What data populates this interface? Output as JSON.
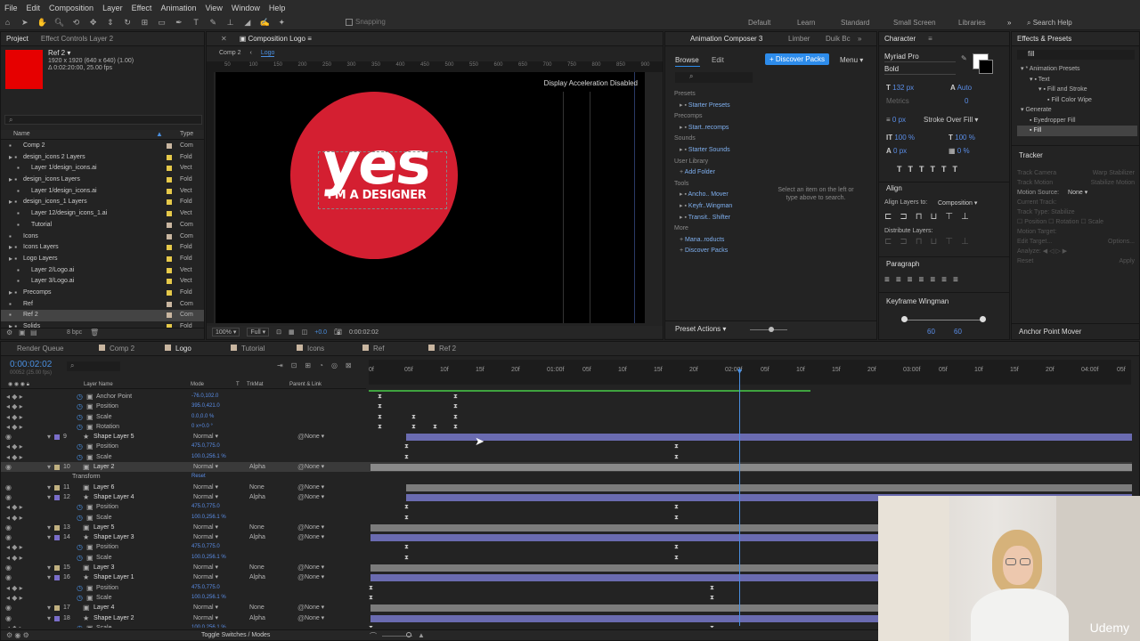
{
  "menu": [
    "File",
    "Edit",
    "Composition",
    "Layer",
    "Effect",
    "Animation",
    "View",
    "Window",
    "Help"
  ],
  "toolbar": {
    "snapping": "Snapping",
    "workspaces": [
      "Default",
      "Learn",
      "Standard",
      "Small Screen",
      "Libraries"
    ],
    "search": "Search Help"
  },
  "project": {
    "tabs": [
      "Project",
      "Effect Controls Layer 2"
    ],
    "selected_name": "Ref 2 ▾",
    "selected_info1": "1920 x 1920 (640 x 640) (1.00)",
    "selected_info2": "Δ 0:02:20:00, 25.00 fps",
    "col_name": "Name",
    "col_type": "Type",
    "bpc": "8 bpc",
    "items": [
      {
        "name": "Comp 2",
        "type": "Com",
        "color": "#c9b6a0",
        "indent": 1
      },
      {
        "name": "design_icons 2 Layers",
        "type": "Fold",
        "color": "#e6c94a",
        "indent": 1
      },
      {
        "name": "Layer 1/design_icons.ai",
        "type": "Vect",
        "color": "#e6c94a",
        "indent": 2
      },
      {
        "name": "design_icons Layers",
        "type": "Fold",
        "color": "#e6c94a",
        "indent": 1
      },
      {
        "name": "Layer 1/design_icons.ai",
        "type": "Vect",
        "color": "#e6c94a",
        "indent": 2
      },
      {
        "name": "design_icons_1 Layers",
        "type": "Fold",
        "color": "#e6c94a",
        "indent": 1
      },
      {
        "name": "Layer 12/design_icons_1.ai",
        "type": "Vect",
        "color": "#e6c94a",
        "indent": 2
      },
      {
        "name": "Tutorial",
        "type": "Com",
        "color": "#c9b6a0",
        "indent": 2
      },
      {
        "name": "Icons",
        "type": "Com",
        "color": "#c9b6a0",
        "indent": 1
      },
      {
        "name": "Icons Layers",
        "type": "Fold",
        "color": "#e6c94a",
        "indent": 1
      },
      {
        "name": "Logo Layers",
        "type": "Fold",
        "color": "#e6c94a",
        "indent": 1
      },
      {
        "name": "Layer 2/Logo.ai",
        "type": "Vect",
        "color": "#e6c94a",
        "indent": 2
      },
      {
        "name": "Layer 3/Logo.ai",
        "type": "Vect",
        "color": "#e6c94a",
        "indent": 2
      },
      {
        "name": "Precomps",
        "type": "Fold",
        "color": "#e6c94a",
        "indent": 1
      },
      {
        "name": "Ref",
        "type": "Com",
        "color": "#c9b6a0",
        "indent": 1
      },
      {
        "name": "Ref 2",
        "type": "Com",
        "color": "#c9b6a0",
        "indent": 1,
        "selected": true
      },
      {
        "name": "Solids",
        "type": "Fold",
        "color": "#e6c94a",
        "indent": 1
      }
    ]
  },
  "comp": {
    "tab": "Composition Logo",
    "crumbs": [
      "Comp 2",
      "Logo"
    ],
    "accel": "Display Acceleration Disabled",
    "logo_big": "yes",
    "logo_small": "I'M A DESIGNER",
    "zoom": "100%",
    "res": "Full",
    "time": "0:00:02:02",
    "plus": "+0.0",
    "ruler": [
      "50",
      "100",
      "150",
      "200",
      "250",
      "300",
      "350",
      "400",
      "450",
      "500",
      "550",
      "600",
      "650",
      "700",
      "750",
      "800",
      "850",
      "900"
    ]
  },
  "ac3": {
    "tabs": [
      "Animation Composer 3",
      "Limber",
      "Duik Bc"
    ],
    "browse": "Browse",
    "edit": "Edit",
    "discover": "Discover Packs",
    "menu_btn": "Menu",
    "sections": [
      {
        "head": "Presets",
        "items": [
          "Starter Presets"
        ]
      },
      {
        "head": "Precomps",
        "items": [
          "Start..recomps"
        ]
      },
      {
        "head": "Sounds",
        "items": [
          "Starter Sounds"
        ]
      },
      {
        "head": "User Library",
        "items": [
          "Add Folder"
        ]
      },
      {
        "head": "Tools",
        "items": [
          "Ancho.. Mover",
          "Keyfr..Wingman",
          "Transit.. Shifter"
        ]
      },
      {
        "head": "More",
        "items": [
          "Mana..roducts",
          "Discover Packs"
        ]
      }
    ],
    "hint": "Select an item on the left or type above to search.",
    "preset_actions": "Preset Actions"
  },
  "character": {
    "title": "Character",
    "font": "Myriad Pro",
    "style": "Bold",
    "size": "132 px",
    "leading": "Auto",
    "tracking_label": "Metrics",
    "tracking": "0",
    "stroke": "0 px",
    "stroke_mode": "Stroke Over Fill",
    "vscale": "100 %",
    "hscale": "100 %",
    "baseline": "0 px",
    "tsume": "0 %"
  },
  "align": {
    "title": "Align",
    "align_to_label": "Align Layers to:",
    "align_to": "Composition",
    "distribute": "Distribute Layers:"
  },
  "paragraph": {
    "title": "Paragraph"
  },
  "kfw": {
    "title": "Keyframe Wingman",
    "v1": "60",
    "v2": "60"
  },
  "effects": {
    "title": "Effects & Presets",
    "search": "fill",
    "tree": [
      "* Animation Presets",
      "Text",
      "Fill and Stroke",
      "Fill Color Wipe",
      "Generate",
      "Eyedropper Fill",
      "Fill"
    ]
  },
  "tracker": {
    "title": "Tracker",
    "buttons": [
      "Track Camera",
      "Warp Stabilizer",
      "Track Motion",
      "Stabilize Motion"
    ],
    "motion_source_label": "Motion Source:",
    "motion_source": "None",
    "current_track": "Current Track:",
    "track_type": "Track Type:",
    "track_type_val": "Stabilize",
    "pos": "Position",
    "rot": "Rotation",
    "scale": "Scale",
    "motion_target": "Motion Target:",
    "edit_target": "Edit Target...",
    "options": "Options...",
    "analyze": "Analyze:",
    "reset": "Reset",
    "apply": "Apply"
  },
  "anchor": {
    "title": "Anchor Point Mover"
  },
  "timeline": {
    "tabs": [
      "Render Queue",
      "Comp 2",
      "Logo",
      "Tutorial",
      "Icons",
      "Ref",
      "Ref 2"
    ],
    "time": "0:00:02:02",
    "frames": "00052 (25.00 fps)",
    "col_layer": "Layer Name",
    "col_mode": "Mode",
    "col_t": "T",
    "col_trk": "TrkMat",
    "col_parent": "Parent & Link",
    "footer": "Toggle Switches / Modes",
    "ruler": [
      "0f",
      "05f",
      "10f",
      "15f",
      "20f",
      "01:00f",
      "05f",
      "10f",
      "15f",
      "20f",
      "02:00f",
      "05f",
      "10f",
      "15f",
      "20f",
      "03:00f",
      "05f",
      "10f",
      "15f",
      "20f",
      "04:00f",
      "05f"
    ],
    "rows": [
      {
        "kind": "prop",
        "name": "Anchor Point",
        "val": "-76.0,102.0",
        "keys": [
          10,
          95
        ]
      },
      {
        "kind": "prop",
        "name": "Position",
        "val": "395.0,421.0",
        "keys": [
          10,
          95
        ]
      },
      {
        "kind": "prop",
        "name": "Scale",
        "val": "0.0,0.0 %",
        "keys": [
          10,
          48,
          95
        ]
      },
      {
        "kind": "prop",
        "name": "Rotation",
        "val": "0 x+0.0 °",
        "keys": [
          10,
          48,
          72,
          95
        ]
      },
      {
        "kind": "layer",
        "num": "9",
        "name": "Shape Layer 5",
        "mode": "Normal",
        "trk": "",
        "parent": "None",
        "color": "#7a6ec9",
        "star": true,
        "bar": [
          40,
          1270
        ],
        "barc": "#6a6bb0"
      },
      {
        "kind": "prop",
        "name": "Position",
        "val": "475.0,775.0",
        "keys": [
          40,
          343
        ]
      },
      {
        "kind": "prop",
        "name": "Scale",
        "val": "100.0,256.1 %",
        "keys": [
          40,
          343
        ]
      },
      {
        "kind": "layer",
        "num": "10",
        "name": "Layer 2",
        "mode": "Normal",
        "trk": "Alpha",
        "parent": "None",
        "color": "#c0b080",
        "bar": [
          0,
          1270
        ],
        "barc": "#8a8a8a",
        "selected": true
      },
      {
        "kind": "sub",
        "name": "Transform",
        "val": "Reset"
      },
      {
        "kind": "layer",
        "num": "11",
        "name": "Layer 6",
        "mode": "Normal",
        "trk": "None",
        "parent": "None",
        "color": "#c0b080",
        "bar": [
          40,
          1270
        ],
        "barc": "#7c7c7c"
      },
      {
        "kind": "layer",
        "num": "12",
        "name": "Shape Layer 4",
        "mode": "Normal",
        "trk": "Alpha",
        "parent": "None",
        "color": "#7a6ec9",
        "star": true,
        "bar": [
          40,
          1270
        ],
        "barc": "#6a6bb0"
      },
      {
        "kind": "prop",
        "name": "Position",
        "val": "475.0,775.0",
        "keys": [
          40,
          343
        ]
      },
      {
        "kind": "prop",
        "name": "Scale",
        "val": "100.0,256.1 %",
        "keys": [
          40,
          343
        ]
      },
      {
        "kind": "layer",
        "num": "13",
        "name": "Layer 5",
        "mode": "Normal",
        "trk": "None",
        "parent": "None",
        "color": "#c0b080",
        "bar": [
          0,
          1270
        ],
        "barc": "#7c7c7c"
      },
      {
        "kind": "layer",
        "num": "14",
        "name": "Shape Layer 3",
        "mode": "Normal",
        "trk": "Alpha",
        "parent": "None",
        "color": "#7a6ec9",
        "star": true,
        "bar": [
          0,
          1270
        ],
        "barc": "#6a6bb0"
      },
      {
        "kind": "prop",
        "name": "Position",
        "val": "475.0,775.0",
        "keys": [
          40,
          343
        ]
      },
      {
        "kind": "prop",
        "name": "Scale",
        "val": "100.0,256.1 %",
        "keys": [
          40,
          343
        ]
      },
      {
        "kind": "layer",
        "num": "15",
        "name": "Layer 3",
        "mode": "Normal",
        "trk": "None",
        "parent": "None",
        "color": "#c0b080",
        "bar": [
          0,
          1270
        ],
        "barc": "#7c7c7c"
      },
      {
        "kind": "layer",
        "num": "16",
        "name": "Shape Layer 1",
        "mode": "Normal",
        "trk": "Alpha",
        "parent": "None",
        "color": "#7a6ec9",
        "star": true,
        "bar": [
          0,
          1270
        ],
        "barc": "#6a6bb0"
      },
      {
        "kind": "prop",
        "name": "Position",
        "val": "475.0,775.0",
        "keys": [
          0,
          383
        ]
      },
      {
        "kind": "prop",
        "name": "Scale",
        "val": "100.0,256.1 %",
        "keys": [
          0,
          383
        ]
      },
      {
        "kind": "layer",
        "num": "17",
        "name": "Layer 4",
        "mode": "Normal",
        "trk": "None",
        "parent": "None",
        "color": "#c0b080",
        "bar": [
          0,
          1270
        ],
        "barc": "#7c7c7c"
      },
      {
        "kind": "layer",
        "num": "18",
        "name": "Shape Layer 2",
        "mode": "Normal",
        "trk": "Alpha",
        "parent": "None",
        "color": "#7a6ec9",
        "star": true,
        "bar": [
          0,
          1270
        ],
        "barc": "#6a6bb0"
      },
      {
        "kind": "prop",
        "name": "Scale",
        "val": "100.0,256.1 %",
        "keys": [
          0,
          383
        ]
      }
    ]
  },
  "watermark": "Udemy",
  "colors": {
    "accent": "#2d8ceb",
    "logo_red": "#d41f31",
    "swatch": "#e60000",
    "playhead": "#4a8fe0"
  }
}
